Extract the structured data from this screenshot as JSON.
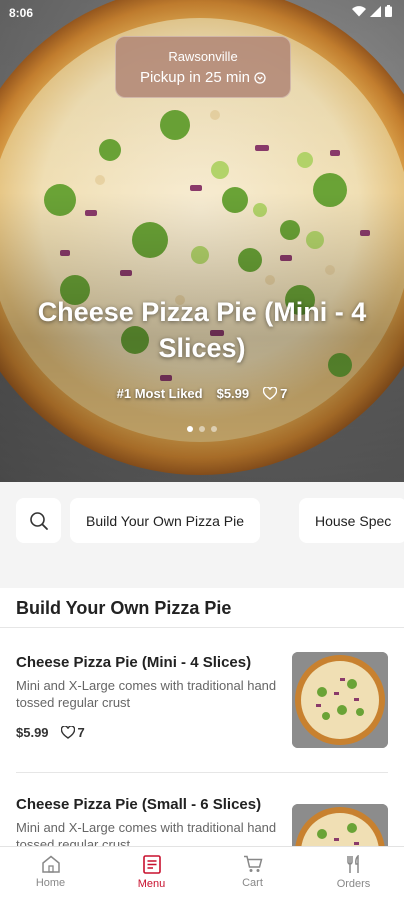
{
  "status_bar": {
    "time": "8:06"
  },
  "hero": {
    "location": "Rawsonville",
    "pickup_text": "Pickup in 25 min",
    "title": "Cheese Pizza Pie (Mini - 4 Slices)",
    "badge": "#1 Most Liked",
    "price": "$5.99",
    "likes": "7",
    "carousel": {
      "count": 3,
      "active_index": 0
    }
  },
  "categories": {
    "search_icon": "search-icon",
    "chips": [
      "Build Your Own Pizza Pie",
      "House Spec"
    ]
  },
  "section": {
    "title": "Build Your Own Pizza Pie"
  },
  "items": [
    {
      "name": "Cheese Pizza Pie (Mini - 4 Slices)",
      "description": "Mini and X-Large comes with traditional hand tossed regular crust",
      "price": "$5.99",
      "likes": "7"
    },
    {
      "name": "Cheese Pizza Pie (Small - 6 Slices)",
      "description": "Mini and X-Large comes with traditional hand tossed regular crust"
    }
  ],
  "nav": {
    "items": [
      {
        "label": "Home",
        "icon": "home-icon"
      },
      {
        "label": "Menu",
        "icon": "menu-icon"
      },
      {
        "label": "Cart",
        "icon": "cart-icon"
      },
      {
        "label": "Orders",
        "icon": "orders-icon"
      }
    ],
    "active": "Menu"
  },
  "colors": {
    "accent": "#c8102e",
    "pill": "#b28776"
  }
}
